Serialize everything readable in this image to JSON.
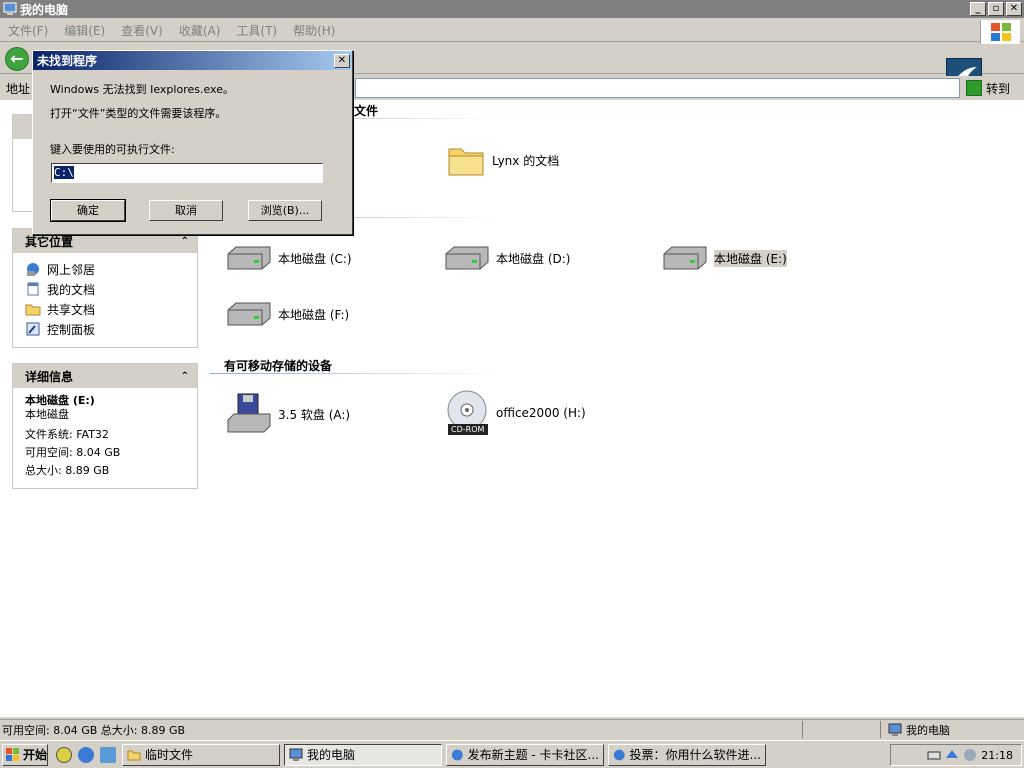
{
  "window": {
    "title": "我的电脑"
  },
  "menu": [
    "文件(F)",
    "编辑(E)",
    "查看(V)",
    "收藏(A)",
    "工具(T)",
    "帮助(H)"
  ],
  "address": {
    "label": "地址",
    "go_label": "转到"
  },
  "section_partial_label": "文件",
  "panels": {
    "other_places": {
      "title": "其它位置",
      "items": [
        {
          "label": "网上邻居",
          "icon": "network-icon"
        },
        {
          "label": "我的文档",
          "icon": "document-icon"
        },
        {
          "label": "共享文档",
          "icon": "folder-icon"
        },
        {
          "label": "控制面板",
          "icon": "control-panel-icon"
        }
      ]
    },
    "details": {
      "title": "详细信息",
      "name": "本地磁盘 (E:)",
      "type": "本地磁盘",
      "fs": "文件系统: FAT32",
      "free": "可用空间: 8.04 GB",
      "total": "总大小: 8.89 GB"
    }
  },
  "content": {
    "folder_item": "Lynx 的文档",
    "drives": [
      "本地磁盘 (C:)",
      "本地磁盘 (D:)",
      "本地磁盘 (E:)",
      "本地磁盘 (F:)"
    ],
    "removable_title": "有可移动存储的设备",
    "removable": [
      "3.5 软盘 (A:)",
      "office2000 (H:)"
    ],
    "cd_badge": "CD-ROM"
  },
  "dialog": {
    "title": "未找到程序",
    "line1": "Windows 无法找到 Iexplores.exe。",
    "line2": "打开“文件”类型的文件需要该程序。",
    "prompt": "键入要使用的可执行文件:",
    "input_value": "C:\\",
    "ok": "确定",
    "cancel": "取消",
    "browse": "浏览(B)..."
  },
  "status": {
    "left": "可用空间: 8.04 GB 总大小: 8.89 GB",
    "right": "我的电脑"
  },
  "taskbar": {
    "start": "开始",
    "tasks": [
      "临时文件",
      "我的电脑",
      "发布新主题 - 卡卡社区...",
      "投票：你用什么软件进..."
    ],
    "clock": "21:18"
  }
}
